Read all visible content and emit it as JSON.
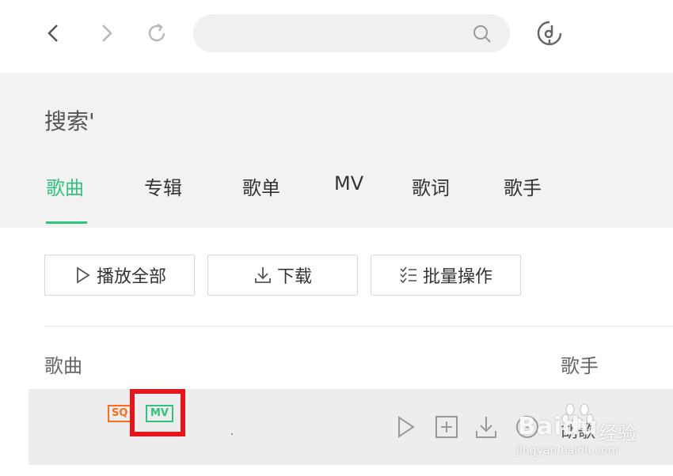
{
  "search": {
    "value": "",
    "placeholder": ""
  },
  "page": {
    "title": "搜索'"
  },
  "tabs": [
    {
      "label": "歌曲",
      "active": true
    },
    {
      "label": "专辑",
      "active": false
    },
    {
      "label": "歌单",
      "active": false
    },
    {
      "label": "MV",
      "active": false
    },
    {
      "label": "歌词",
      "active": false
    },
    {
      "label": "歌手",
      "active": false
    }
  ],
  "actions": {
    "play_all": "播放全部",
    "download": "下载",
    "batch": "批量操作"
  },
  "columns": {
    "song": "歌曲",
    "artist": "歌手"
  },
  "song_row": {
    "sq_badge": "SQ",
    "mv_badge": "MV",
    "artist": "胡歌"
  },
  "watermark": {
    "logo": "Baidu",
    "cn": "经验",
    "url": "jingyan.baidu.com"
  },
  "icons": {
    "back": "chevron-left-icon",
    "forward": "chevron-right-icon",
    "refresh": "refresh-icon",
    "search": "search-icon",
    "music": "music-note-icon",
    "play": "play-icon",
    "add": "add-to-playlist-icon",
    "download": "download-icon",
    "batch": "batch-check-icon"
  },
  "colors": {
    "accent": "#31c27c",
    "sq": "#ff6a1e",
    "highlight": "#e8141c"
  }
}
